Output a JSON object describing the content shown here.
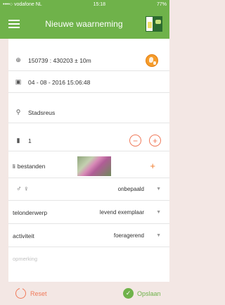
{
  "status_bar": {
    "carrier": "••••○ vodafone NL",
    "time": "15:18",
    "battery": "77%"
  },
  "nav": {
    "title": "Nieuwe waarneming",
    "menu_icon": "hamburger-menu-icon",
    "logo": "app-logo"
  },
  "form": {
    "location": "150739 : 430203 ± 10m",
    "date": "04 - 08 - 2016 15:06:48",
    "species": "Stadsreus",
    "count": "1",
    "files_label": "bestanden",
    "files_prefix": "li",
    "sex_value": "onbepaald",
    "counting_subject_label": "telonderwerp",
    "counting_subject_value": "levend exemplaar",
    "activity_label": "activiteit",
    "activity_value": "foeragerend",
    "remark_placeholder": "opmerking"
  },
  "footer": {
    "reset_label": "Reset",
    "save_label": "Opslaan"
  },
  "colors": {
    "brand_green": "#6fb24a",
    "accent_orange": "#f07a5a",
    "background": "#f3e7e4"
  }
}
